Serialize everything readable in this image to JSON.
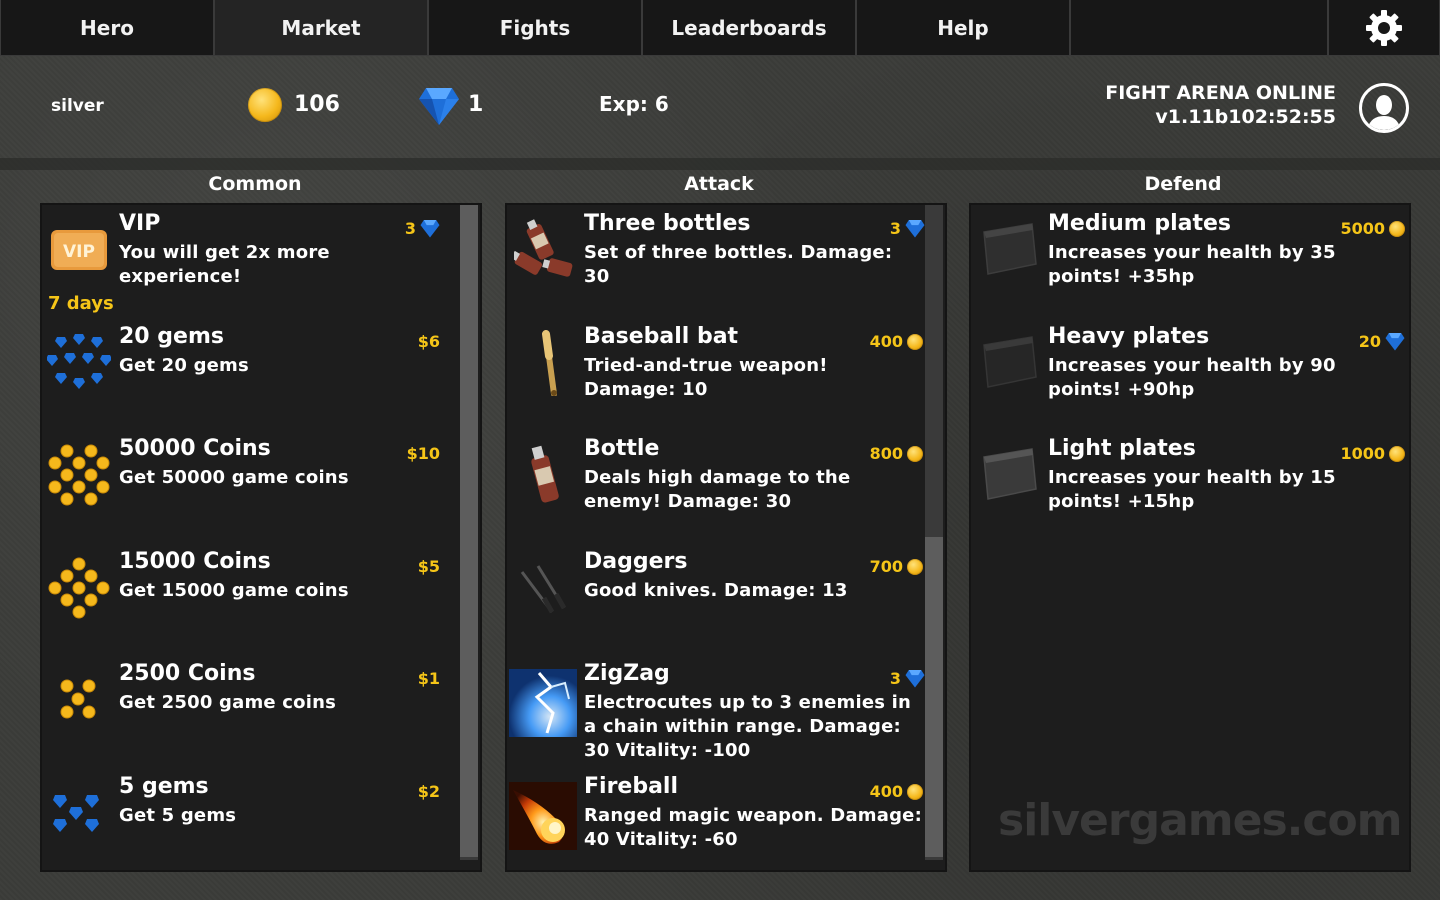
{
  "nav": {
    "tabs": [
      {
        "label": "Hero",
        "active": false
      },
      {
        "label": "Market",
        "active": true
      },
      {
        "label": "Fights",
        "active": false
      },
      {
        "label": "Leaderboards",
        "active": false
      },
      {
        "label": "Help",
        "active": false
      }
    ],
    "settings_icon": "gear-icon"
  },
  "status": {
    "username": "silver",
    "coins": "106",
    "gems": "1",
    "exp": "Exp: 6",
    "game_title": "FIGHT ARENA ONLINE",
    "version": "v1.11b102:52:55"
  },
  "columns": {
    "common": {
      "title": "Common",
      "items": [
        {
          "name": "VIP",
          "desc": "You will get 2x more experience!",
          "price": "3",
          "currency": "gem",
          "extra": "7 days",
          "icon": "vip-icon"
        },
        {
          "name": "20 gems",
          "desc": "Get 20 gems",
          "price": "$6",
          "currency": "usd",
          "icon": "gems-icon"
        },
        {
          "name": "50000 Coins",
          "desc": "Get 50000 game coins",
          "price": "$10",
          "currency": "usd",
          "icon": "coins-icon"
        },
        {
          "name": "15000 Coins",
          "desc": "Get 15000 game coins",
          "price": "$5",
          "currency": "usd",
          "icon": "coins-icon"
        },
        {
          "name": "2500 Coins",
          "desc": "Get 2500 game coins",
          "price": "$1",
          "currency": "usd",
          "icon": "coins-icon"
        },
        {
          "name": "5 gems",
          "desc": "Get 5 gems",
          "price": "$2",
          "currency": "usd",
          "icon": "gems-icon"
        }
      ]
    },
    "attack": {
      "title": "Attack",
      "items": [
        {
          "name": "Three bottles",
          "desc": "Set of three bottles. Damage: 30",
          "price": "3",
          "currency": "gem",
          "icon": "bottles-icon"
        },
        {
          "name": "Baseball bat",
          "desc": "Tried-and-true weapon! Damage: 10",
          "price": "400",
          "currency": "coin",
          "icon": "bat-icon"
        },
        {
          "name": "Bottle",
          "desc": "Deals high damage to the enemy! Damage: 30",
          "price": "800",
          "currency": "coin",
          "icon": "bottle-icon"
        },
        {
          "name": "Daggers",
          "desc": "Good knives. Damage: 13",
          "price": "700",
          "currency": "coin",
          "icon": "daggers-icon"
        },
        {
          "name": "ZigZag",
          "desc": "Electrocutes up to 3 enemies in a chain within range. Damage: 30 Vitality: -100",
          "price": "3",
          "currency": "gem",
          "icon": "lightning-icon"
        },
        {
          "name": "Fireball",
          "desc": "Ranged magic weapon. Damage: 40 Vitality: -60",
          "price": "400",
          "currency": "coin",
          "icon": "fireball-icon"
        }
      ]
    },
    "defend": {
      "title": "Defend",
      "items": [
        {
          "name": "Medium plates",
          "desc": "Increases your health by 35 points! +35hp",
          "price": "5000",
          "currency": "coin",
          "icon": "plate-icon"
        },
        {
          "name": "Heavy plates",
          "desc": "Increases your health by 90 points! +90hp",
          "price": "20",
          "currency": "gem",
          "icon": "plate-icon"
        },
        {
          "name": "Light plates",
          "desc": "Increases your health by 15 points! +15hp",
          "price": "1000",
          "currency": "coin",
          "icon": "plate-icon"
        }
      ]
    }
  },
  "watermark": "silvergames.com",
  "colors": {
    "price": "#f5c518",
    "panel": "#1d1d1d",
    "gem": "#1e6fd9",
    "coin": "#f5b81c"
  }
}
